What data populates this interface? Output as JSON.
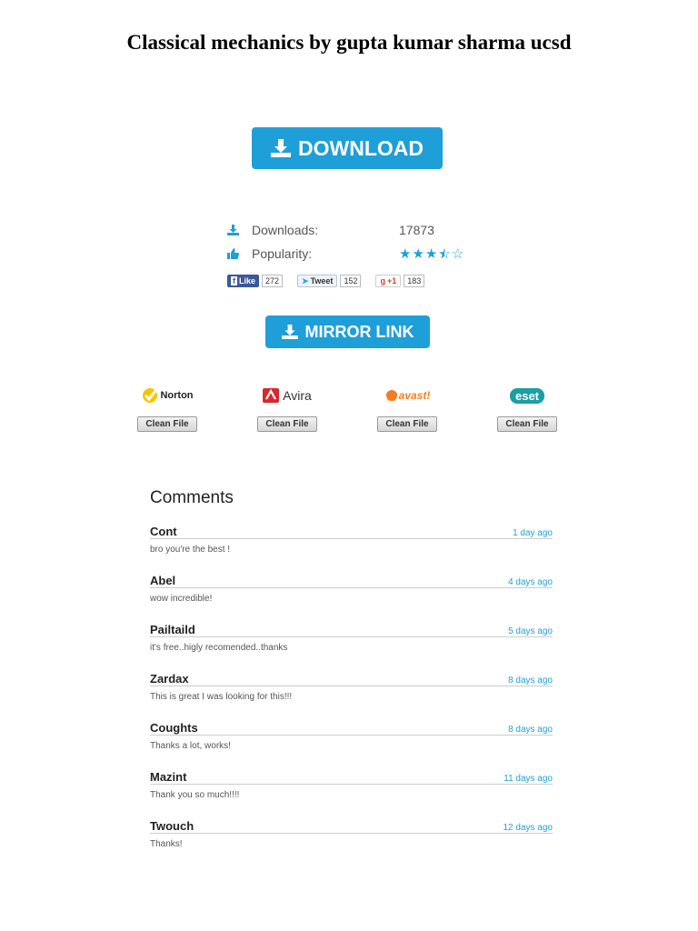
{
  "page": {
    "title": "Classical mechanics by gupta kumar sharma ucsd"
  },
  "download_button": {
    "label": "DOWNLOAD",
    "icon": "download-icon"
  },
  "stats": {
    "downloads_label": "Downloads:",
    "downloads_value": "17873",
    "popularity_label": "Popularity:",
    "rating": 3.5,
    "rating_max": 5
  },
  "social": {
    "facebook": {
      "label": "Like",
      "count": "272"
    },
    "twitter": {
      "label": "Tweet",
      "count": "152"
    },
    "gplus": {
      "label": "+1",
      "count": "183"
    }
  },
  "mirror_button": {
    "label": "MIRROR LINK",
    "icon": "download-icon"
  },
  "antivirus": [
    {
      "name": "Norton",
      "button": "Clean File"
    },
    {
      "name": "Avira",
      "button": "Clean File"
    },
    {
      "name": "avast!",
      "button": "Clean File"
    },
    {
      "name": "eset",
      "button": "Clean File"
    }
  ],
  "comments": {
    "heading": "Comments",
    "items": [
      {
        "name": "Cont",
        "time": "1 day ago",
        "text": "bro you're the best !"
      },
      {
        "name": "Abel",
        "time": "4 days ago",
        "text": "wow incredible!"
      },
      {
        "name": "Pailtaild",
        "time": "5 days ago",
        "text": "it's free..higly recomended..thanks"
      },
      {
        "name": "Zardax",
        "time": "8 days ago",
        "text": "This is great I was looking for this!!!"
      },
      {
        "name": "Coughts",
        "time": "8 days ago",
        "text": "Thanks a lot, works!"
      },
      {
        "name": "Mazint",
        "time": "11 days ago",
        "text": "Thank you so much!!!!"
      },
      {
        "name": "Twouch",
        "time": "12 days ago",
        "text": "Thanks!"
      }
    ]
  },
  "colors": {
    "accent": "#1e9fd8",
    "facebook": "#3b5998"
  }
}
